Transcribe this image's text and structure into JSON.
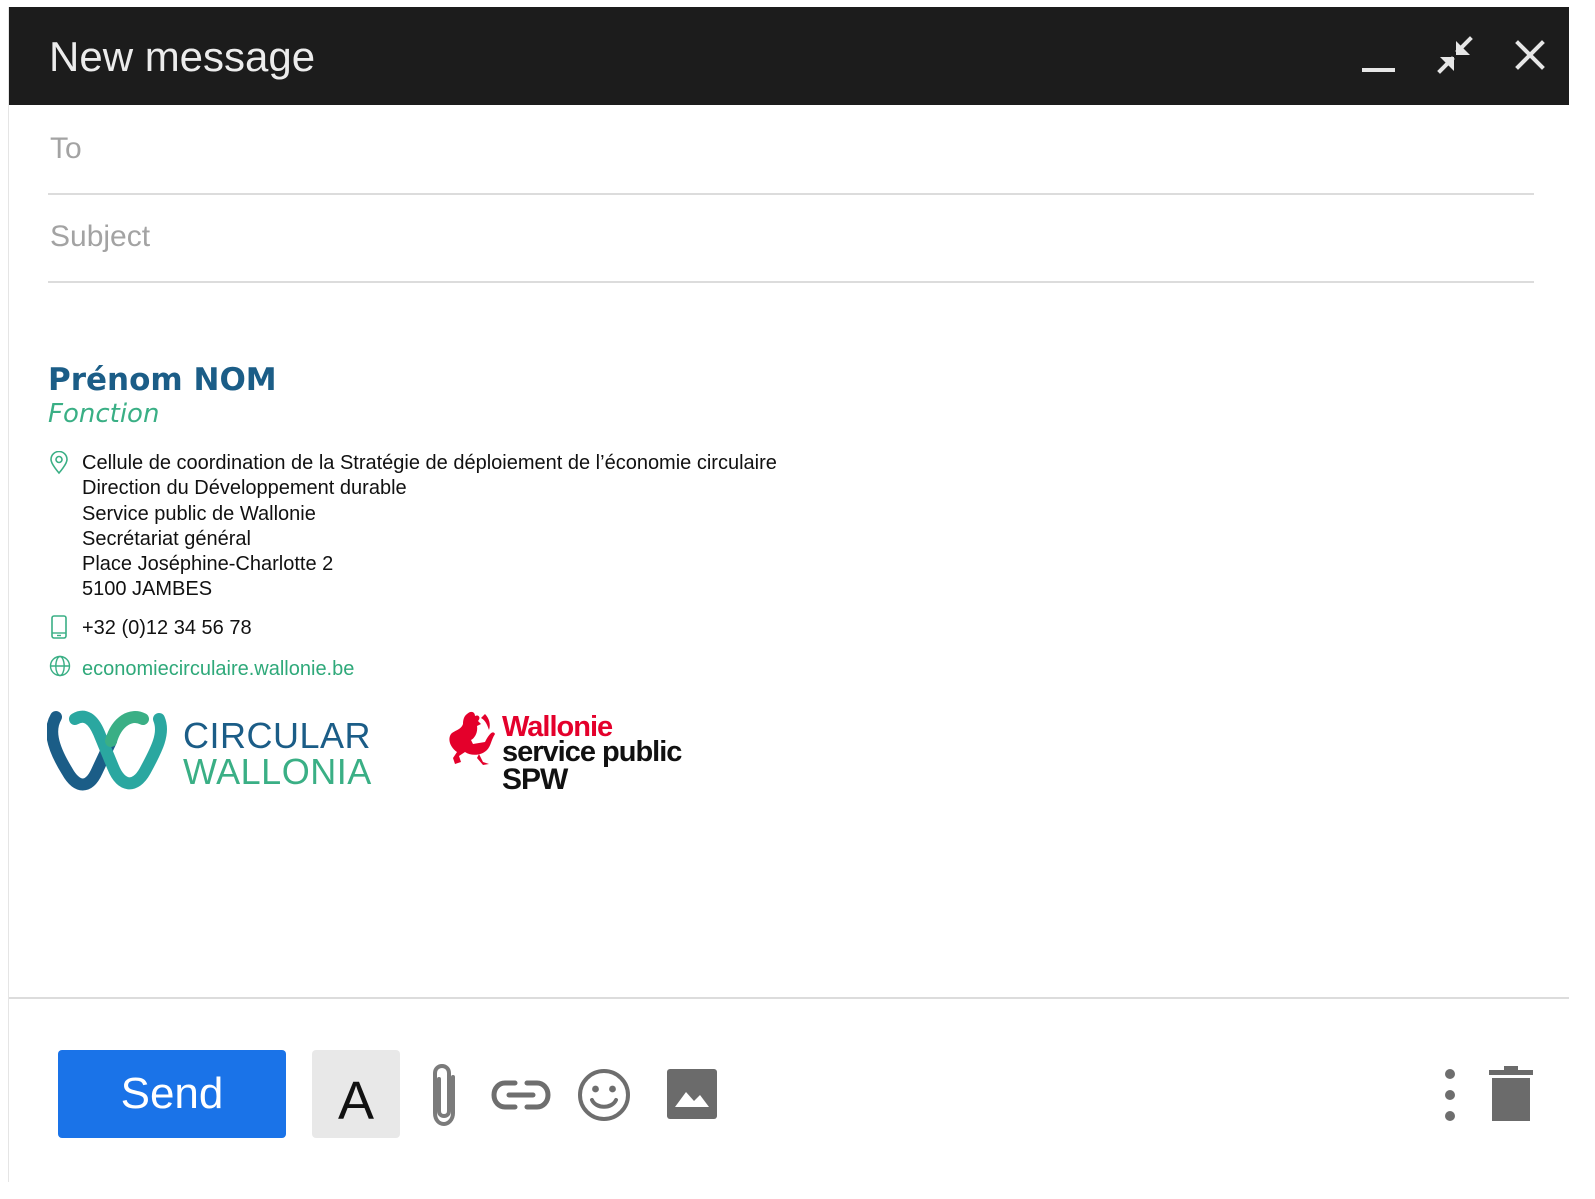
{
  "window": {
    "title": "New message"
  },
  "fields": {
    "to_placeholder": "To",
    "subject_placeholder": "Subject"
  },
  "signature": {
    "name": "Prénom NOM",
    "role": "Fonction",
    "address": [
      "Cellule de coordination de la Stratégie de déploiement de l’économie circulaire",
      "Direction du Développement durable",
      "Service public de Wallonie",
      "Secrétariat général",
      "Place Joséphine-Charlotte 2",
      "5100 JAMBES"
    ],
    "phone": "+32 (0)12 34 56 78",
    "website": "economiecirculaire.wallonie.be",
    "logo_circular": {
      "line1": "CIRCULAR",
      "line2": "WALLONIA"
    },
    "logo_spw": {
      "line1": "Wallonie",
      "line2": "service public",
      "line3": "SPW"
    }
  },
  "toolbar": {
    "send_label": "Send",
    "format_label": "A"
  },
  "colors": {
    "titlebar": "#1c1c1c",
    "send_button": "#1a73e8",
    "name_blue": "#1b5d87",
    "accent_green": "#3aaf85",
    "spw_red": "#e4002b"
  }
}
